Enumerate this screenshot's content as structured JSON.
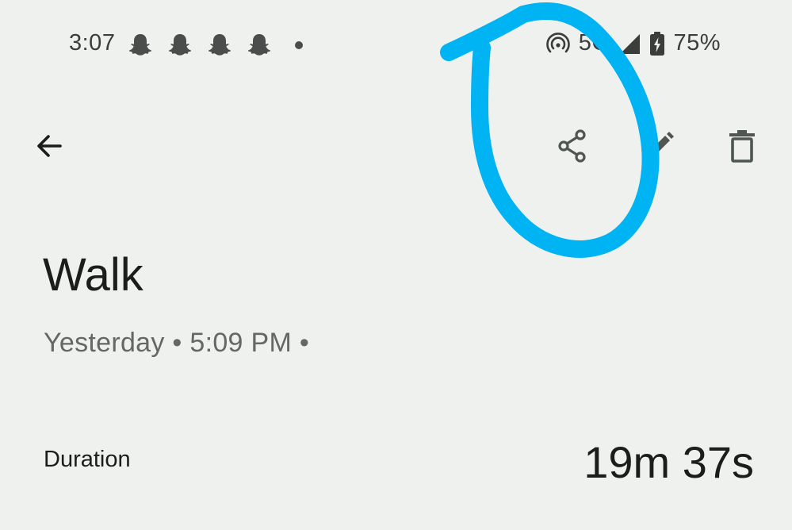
{
  "status_bar": {
    "time": "3:07",
    "notification_icons": [
      "snapchat-icon",
      "snapchat-icon",
      "snapchat-icon",
      "snapchat-icon"
    ],
    "network": "5G",
    "battery": "75%"
  },
  "top_bar": {
    "back_icon": "arrow-left-icon",
    "share_icon": "share-icon",
    "edit_icon": "pencil-icon",
    "delete_icon": "trash-icon"
  },
  "activity": {
    "title": "Walk",
    "subtitle": "Yesterday • 5:09 PM •"
  },
  "stats": {
    "duration_label": "Duration",
    "duration_value": "19m 37s"
  },
  "colors": {
    "background": "#eff1ef",
    "annotation": "#00b3f2",
    "icon": "#4f5552"
  }
}
